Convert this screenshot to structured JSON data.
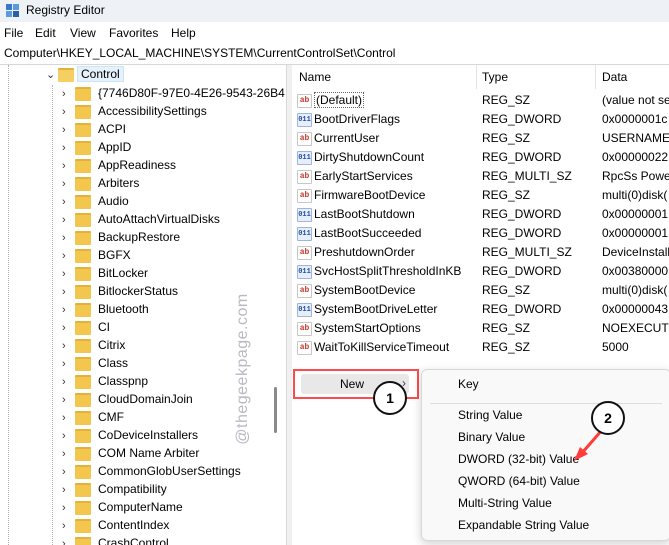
{
  "window": {
    "title": "Registry Editor"
  },
  "menu": [
    "File",
    "Edit",
    "View",
    "Favorites",
    "Help"
  ],
  "address": "Computer\\HKEY_LOCAL_MACHINE\\SYSTEM\\CurrentControlSet\\Control",
  "tree": {
    "selected": "Control",
    "children": [
      "{7746D80F-97E0-4E26-9543-26B4",
      "AccessibilitySettings",
      "ACPI",
      "AppID",
      "AppReadiness",
      "Arbiters",
      "Audio",
      "AutoAttachVirtualDisks",
      "BackupRestore",
      "BGFX",
      "BitLocker",
      "BitlockerStatus",
      "Bluetooth",
      "CI",
      "Citrix",
      "Class",
      "Classpnp",
      "CloudDomainJoin",
      "CMF",
      "CoDeviceInstallers",
      "COM Name Arbiter",
      "CommonGlobUserSettings",
      "Compatibility",
      "ComputerName",
      "ContentIndex",
      "CrashControl"
    ]
  },
  "list": {
    "columns": {
      "name": "Name",
      "type": "Type",
      "data": "Data"
    },
    "rows": [
      {
        "name": "(Default)",
        "type": "REG_SZ",
        "data": "(value not se",
        "icon": "string-value-icon"
      },
      {
        "name": "BootDriverFlags",
        "type": "REG_DWORD",
        "data": "0x0000001c (",
        "icon": "binary-value-icon"
      },
      {
        "name": "CurrentUser",
        "type": "REG_SZ",
        "data": "USERNAME",
        "icon": "string-value-icon"
      },
      {
        "name": "DirtyShutdownCount",
        "type": "REG_DWORD",
        "data": "0x00000022 (",
        "icon": "binary-value-icon"
      },
      {
        "name": "EarlyStartServices",
        "type": "REG_MULTI_SZ",
        "data": "RpcSs Power",
        "icon": "string-value-icon"
      },
      {
        "name": "FirmwareBootDevice",
        "type": "REG_SZ",
        "data": "multi(0)disk(",
        "icon": "string-value-icon"
      },
      {
        "name": "LastBootShutdown",
        "type": "REG_DWORD",
        "data": "0x00000001 (",
        "icon": "binary-value-icon"
      },
      {
        "name": "LastBootSucceeded",
        "type": "REG_DWORD",
        "data": "0x00000001 (",
        "icon": "binary-value-icon"
      },
      {
        "name": "PreshutdownOrder",
        "type": "REG_MULTI_SZ",
        "data": "DeviceInstall",
        "icon": "string-value-icon"
      },
      {
        "name": "SvcHostSplitThresholdInKB",
        "type": "REG_DWORD",
        "data": "0x00380000 (",
        "icon": "binary-value-icon"
      },
      {
        "name": "SystemBootDevice",
        "type": "REG_SZ",
        "data": "multi(0)disk(",
        "icon": "string-value-icon"
      },
      {
        "name": "SystemBootDriveLetter",
        "type": "REG_DWORD",
        "data": "0x00000043 (",
        "icon": "binary-value-icon"
      },
      {
        "name": "SystemStartOptions",
        "type": "REG_SZ",
        "data": " NOEXECUTE",
        "icon": "string-value-icon"
      },
      {
        "name": "WaitToKillServiceTimeout",
        "type": "REG_SZ",
        "data": "5000",
        "icon": "string-value-icon"
      }
    ]
  },
  "context_menu": {
    "new_label": "New",
    "submenu": [
      "Key",
      "String Value",
      "Binary Value",
      "DWORD (32-bit) Value",
      "QWORD (64-bit) Value",
      "Multi-String Value",
      "Expandable String Value"
    ]
  },
  "callouts": [
    "1",
    "2"
  ],
  "watermark": "@thegeekpage.com",
  "colors": {
    "callout_border": "#ff4b4b",
    "arrow": "#ff3b3b",
    "folder": "#f3c64d"
  }
}
